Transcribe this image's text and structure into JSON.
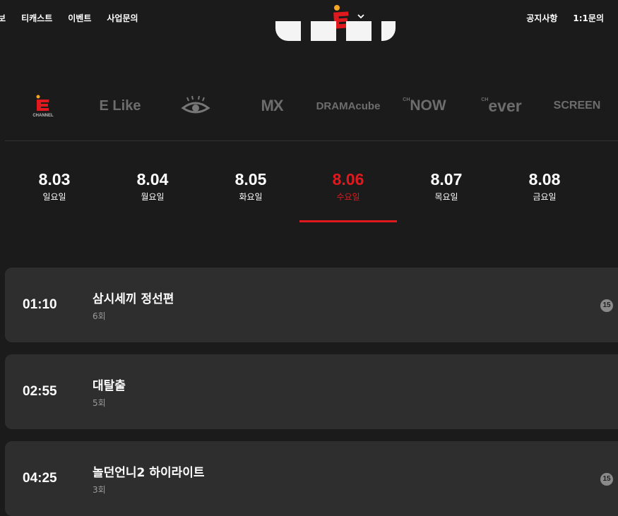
{
  "nav": {
    "left": [
      "정보",
      "티캐스트",
      "이벤트",
      "사업문의"
    ],
    "right": [
      "공지사항",
      "1:1문의"
    ]
  },
  "channels": [
    {
      "name": "E CHANNEL",
      "label": "CHANNEL",
      "icon": "echannel-logo-icon"
    },
    {
      "name": "E Like",
      "label": "E Like",
      "icon": "elike-logo-icon"
    },
    {
      "name": "eye",
      "icon": "eye-channel-logo-icon"
    },
    {
      "name": "MX",
      "label": "MX",
      "icon": "mx-logo-icon"
    },
    {
      "name": "DRAMAcube",
      "label": "DRAMAcube",
      "icon": "dramacube-logo-icon"
    },
    {
      "name": "CH NOW",
      "prefix": "CH",
      "label": "NOW",
      "icon": "chnow-logo-icon"
    },
    {
      "name": "CH ever",
      "prefix": "CH",
      "label": "ever",
      "icon": "chever-logo-icon"
    },
    {
      "name": "SCREEN",
      "label": "SCREEN",
      "icon": "screen-logo-icon"
    }
  ],
  "dates": [
    {
      "date": "8.03",
      "weekday": "일요일",
      "active": false
    },
    {
      "date": "8.04",
      "weekday": "월요일",
      "active": false
    },
    {
      "date": "8.05",
      "weekday": "화요일",
      "active": false
    },
    {
      "date": "8.06",
      "weekday": "수요일",
      "active": true
    },
    {
      "date": "8.07",
      "weekday": "목요일",
      "active": false
    },
    {
      "date": "8.08",
      "weekday": "금요일",
      "active": false
    }
  ],
  "schedule": [
    {
      "time": "01:10",
      "title": "삼시세끼 정선편",
      "episode": "6회",
      "rating": "15"
    },
    {
      "time": "02:55",
      "title": "대탈출",
      "episode": "5회",
      "rating": ""
    },
    {
      "time": "04:25",
      "title": "놀던언니2 하이라이트",
      "episode": "3회",
      "rating": "15"
    }
  ],
  "colors": {
    "accent": "#e0191f",
    "background": "#1b1b1b",
    "card": "#2e2e2e"
  }
}
